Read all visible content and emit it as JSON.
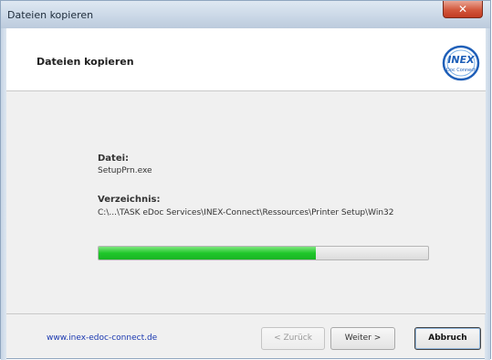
{
  "window": {
    "title": "Dateien kopieren",
    "close_label": "✕"
  },
  "header": {
    "title": "Dateien kopieren",
    "logo_text_top": "INEX",
    "logo_text_bottom": "Doc Connect"
  },
  "content": {
    "file_label": "Datei:",
    "file_value": "SetupPrn.exe",
    "dir_label": "Verzeichnis:",
    "dir_value": "C:\\...\\TASK eDoc Services\\INEX-Connect\\Ressources\\Printer Setup\\Win32",
    "progress_fraction": 0.66
  },
  "footer": {
    "link_text": "www.inex-edoc-connect.de",
    "back_label": "< Zurück",
    "next_label": "Weiter >",
    "cancel_label": "Abbruch"
  },
  "colors": {
    "progress": "#1fc72a",
    "link": "#1a38b0"
  }
}
